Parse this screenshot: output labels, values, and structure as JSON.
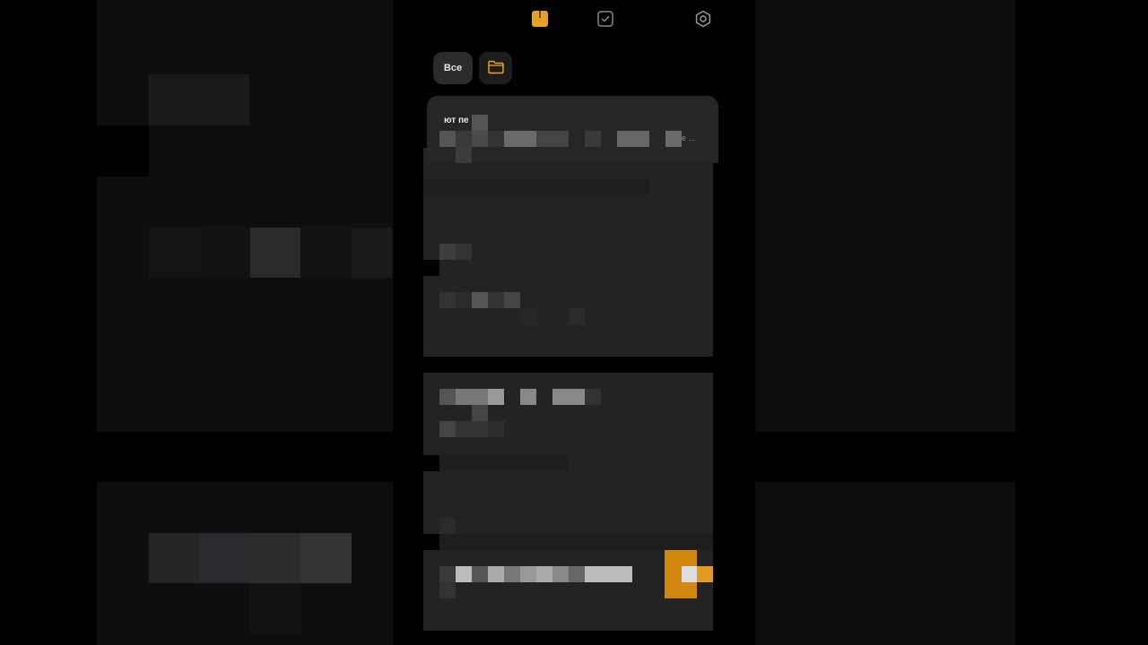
{
  "app": {
    "accent_color": "#e8a020",
    "background_color": "#000000"
  },
  "top_nav": {
    "items": [
      {
        "icon": "notes-icon",
        "active": true
      },
      {
        "icon": "tasks-icon",
        "active": false
      },
      {
        "icon": "settings-icon",
        "active": false
      }
    ]
  },
  "filters": {
    "all_label": "Все",
    "folder_icon": "folder-icon"
  },
  "notes": [
    {
      "title": "ют пе",
      "snippet": "е ..."
    }
  ]
}
